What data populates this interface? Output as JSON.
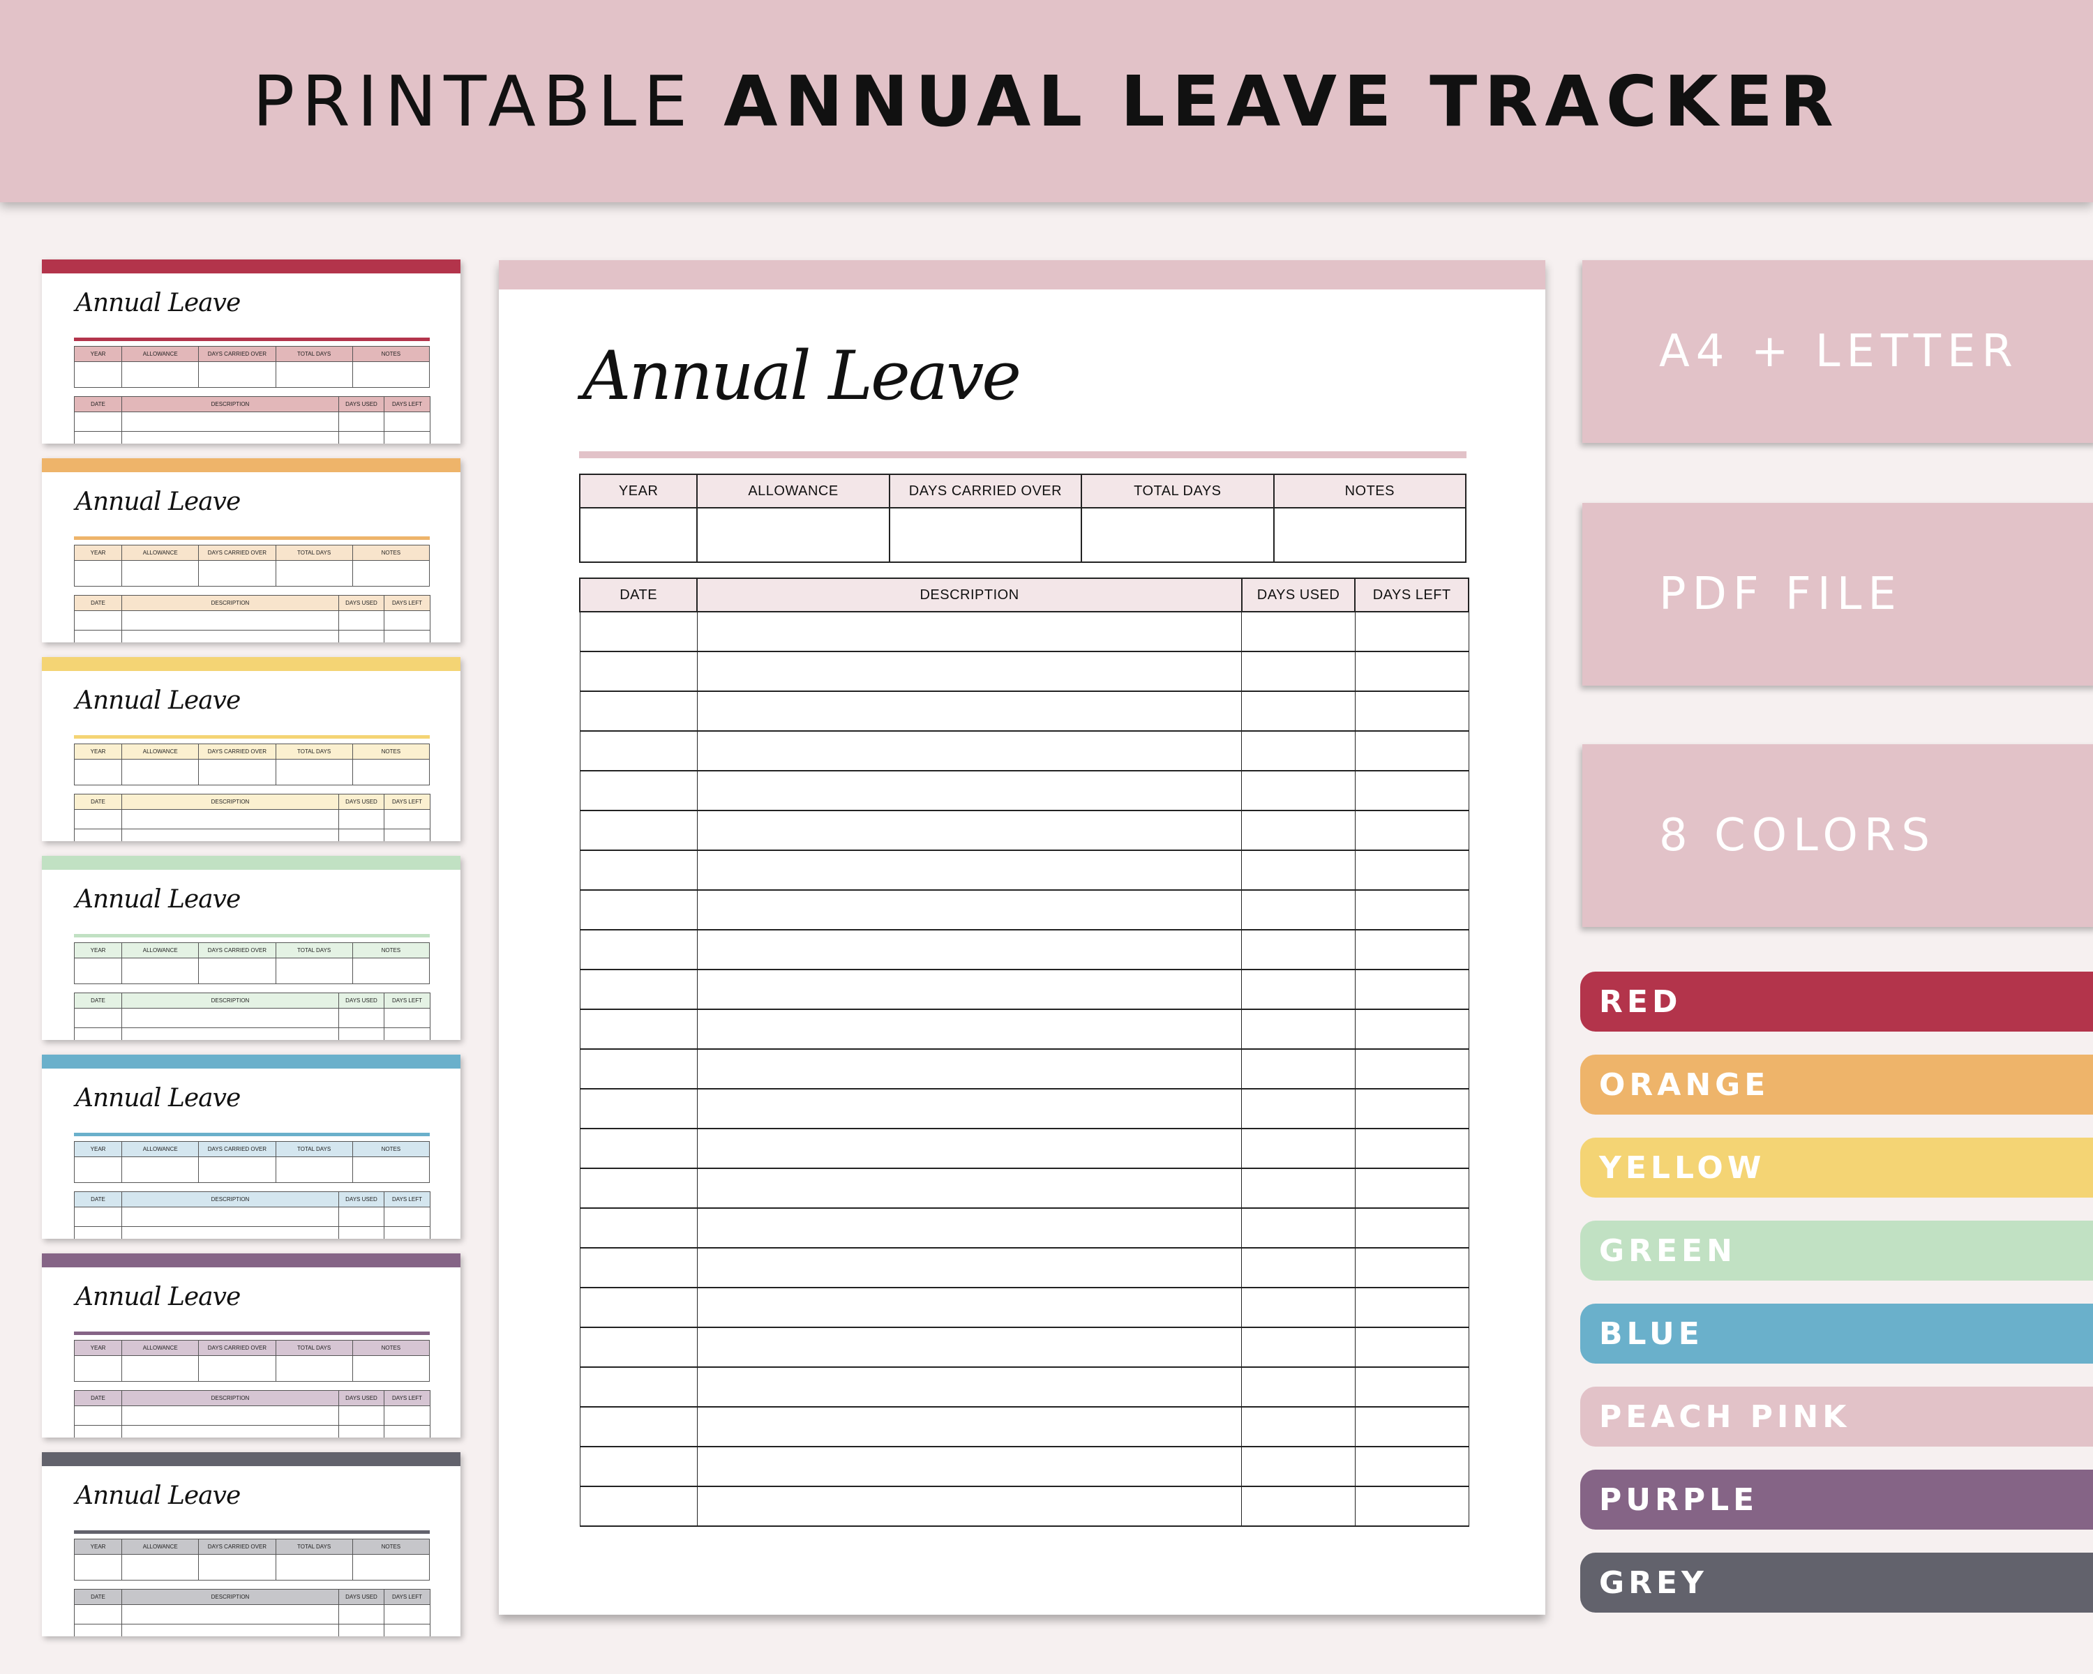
{
  "banner": {
    "title_light": "PRINTABLE",
    "title_bold": "ANNUAL LEAVE TRACKER",
    "background": "#e2c2c8"
  },
  "template": {
    "title": "Annual Leave",
    "summary_headers": [
      "YEAR",
      "ALLOWANCE",
      "DAYS CARRIED OVER",
      "TOTAL DAYS",
      "NOTES"
    ],
    "log_headers": [
      "DATE",
      "DESCRIPTION",
      "DAYS USED",
      "DAYS LEFT"
    ],
    "log_row_count": 23
  },
  "thumbnails": [
    {
      "name": "red",
      "accent": "#b3344b",
      "tint": "#e2b7b9"
    },
    {
      "name": "orange",
      "accent": "#eeb46a",
      "tint": "#f8e4cc"
    },
    {
      "name": "yellow",
      "accent": "#f4d474",
      "tint": "#fbf0d0"
    },
    {
      "name": "green",
      "accent": "#c1e1c3",
      "tint": "#e4f2e4"
    },
    {
      "name": "blue",
      "accent": "#6ab0cb",
      "tint": "#d4e6ef"
    },
    {
      "name": "purple",
      "accent": "#856486",
      "tint": "#d6c5d3"
    },
    {
      "name": "grey",
      "accent": "#62626c",
      "tint": "#c6c6ca"
    }
  ],
  "main_page": {
    "accent": "#e2c2c8",
    "header_tint": "#f3e6e8"
  },
  "features": [
    "A4 + LETTER",
    "PDF FILE",
    "8 COLORS"
  ],
  "colors": [
    {
      "label": "RED",
      "hex": "#b3344b"
    },
    {
      "label": "ORANGE",
      "hex": "#eeb46a"
    },
    {
      "label": "YELLOW",
      "hex": "#f4d474"
    },
    {
      "label": "GREEN",
      "hex": "#c1e1c3"
    },
    {
      "label": "BLUE",
      "hex": "#6ab0cb"
    },
    {
      "label": "PEACH PINK",
      "hex": "#e2c2c8"
    },
    {
      "label": "PURPLE",
      "hex": "#856486"
    },
    {
      "label": "GREY",
      "hex": "#62626c"
    }
  ]
}
